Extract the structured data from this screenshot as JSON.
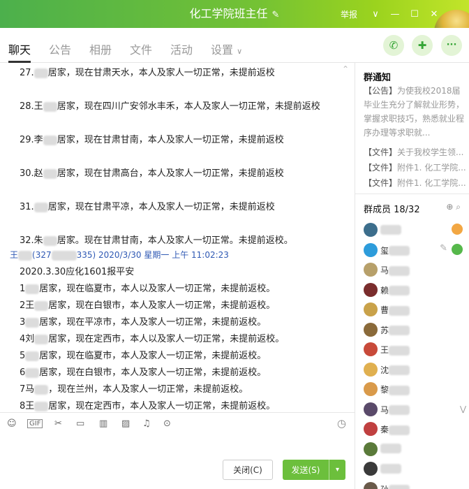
{
  "window": {
    "title": "化工学院班主任",
    "report_label": "举报",
    "edit_icon": "pencil-icon",
    "chevron": "∨",
    "minimize": "—",
    "maximize": "☐",
    "close": "✕"
  },
  "tabs": [
    "聊天",
    "公告",
    "相册",
    "文件",
    "活动",
    "设置"
  ],
  "tab_settings_arrow": "∨",
  "actions": {
    "call_icon": "phone-icon",
    "call_glyph": "✆",
    "chat_icon": "plus-chat-icon",
    "chat_glyph": "✚",
    "more_icon": "more-icon",
    "more_glyph": "···"
  },
  "chat": {
    "lines_top": [
      {
        "prefix": "27.",
        "text": "居家，现在甘肃天水，本人及家人一切正常，未提前返校"
      },
      {
        "prefix": "28.王",
        "text": "居家，现在四川广安邻水丰禾，本人及家人一切正常，未提前返校"
      },
      {
        "prefix": "29.李",
        "text": "居家，现在甘肃甘南，本人及家人一切正常，未提前返校"
      },
      {
        "prefix": "30.赵",
        "text": "居家，现在甘肃高台，本人及家人一切正常，未提前返校"
      },
      {
        "prefix": "31.",
        "text": "居家，现在甘肃平凉，本人及家人一切正常，未提前返校"
      },
      {
        "prefix": "32.朱",
        "text": "居家。现在甘肃甘南，本人及家人一切正常。未提前返校。"
      }
    ],
    "sender": {
      "name_prefix": "王",
      "id_prefix": "(327",
      "id_suffix": "335)",
      "time": "2020/3/30 星期一 上午 11:02:23"
    },
    "header_line": "2020.3.30应化1601报平安",
    "lines_bottom": [
      {
        "prefix": "1",
        "text": "居家，现在临夏市，本人以及家人一切正常，未提前返校。"
      },
      {
        "prefix": "2王",
        "text": "居家，现在白银市，本人及家人一切正常，未提前返校。"
      },
      {
        "prefix": "3",
        "text": "居家，现在平凉市，本人及家人一切正常，未提前返校。"
      },
      {
        "prefix": "4刘",
        "text": "居家，现在定西市，本人以及家人一切正常，未提前返校。"
      },
      {
        "prefix": "5",
        "text": "居家，现在临夏市，本人及家人一切正常，未提前返校。"
      },
      {
        "prefix": "6",
        "text": "居家，现在白银市，本人及家人一切正常，未提前返校。"
      },
      {
        "prefix": "7马",
        "text": "，现在兰州，本人及家人一切正常，未提前返校。"
      },
      {
        "prefix": "8王",
        "text": "居家，现在定西市，本人及家人一切正常，未提前返校。"
      }
    ]
  },
  "toolbar": {
    "icons": [
      "emoji-icon",
      "gif-icon",
      "scissors-icon",
      "folder-icon",
      "file-icon",
      "image-icon",
      "bell-icon",
      "more-circle-icon"
    ],
    "glyphs": [
      "☺",
      "GIF",
      "✂",
      "▭",
      "▥",
      "▨",
      "♫",
      "⊙"
    ],
    "history_icon": "clock-icon",
    "history_glyph": "◷"
  },
  "buttons": {
    "close_label": "关闭(C)",
    "send_label": "发送(S)",
    "send_arrow": "▾"
  },
  "sidebar": {
    "notice_title": "群通知",
    "notices": [
      {
        "tag": "【公告】",
        "text": "为使我校2018届毕业生充分了解就业形势，掌握求职技巧，熟悉就业程序办理等求职就..."
      },
      {
        "tag": "【文件】",
        "text": "关于我校学生领..."
      },
      {
        "tag": "【文件】",
        "text": "附件1. 化工学院..."
      },
      {
        "tag": "【文件】",
        "text": "附件1. 化工学院..."
      }
    ],
    "members_title": "群成员 18/32",
    "members_icons": "⊕ ⌕",
    "members": [
      {
        "initial": "",
        "color": "#3c6e8c"
      },
      {
        "initial": "玺",
        "color": "#2d9cdb"
      },
      {
        "initial": "马",
        "color": "#b7a06a"
      },
      {
        "initial": "赖",
        "color": "#7a2d2d"
      },
      {
        "initial": "曹",
        "color": "#c9a24a"
      },
      {
        "initial": "苏",
        "color": "#8a6a3a"
      },
      {
        "initial": "王",
        "color": "#c84a3a"
      },
      {
        "initial": "沈",
        "color": "#e0b050"
      },
      {
        "initial": "黎",
        "color": "#d99a4a"
      },
      {
        "initial": "马",
        "color": "#5a4a6a"
      },
      {
        "initial": "秦",
        "color": "#c04040"
      },
      {
        "initial": "",
        "color": "#5a7a3a"
      },
      {
        "initial": "",
        "color": "#3a3a3a"
      },
      {
        "initial": "孙",
        "color": "#6a5a4a"
      }
    ],
    "scroll_down": "⋁"
  }
}
